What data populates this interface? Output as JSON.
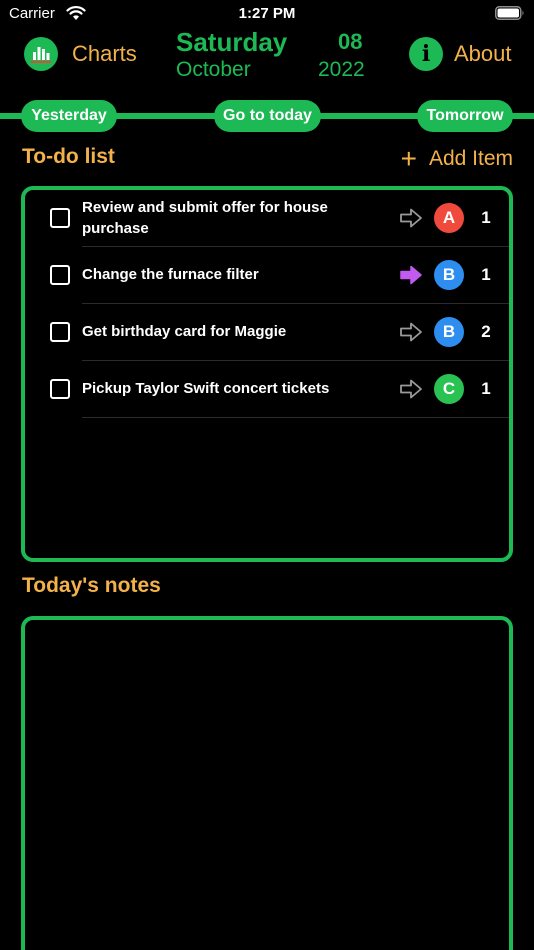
{
  "status": {
    "carrier": "Carrier",
    "time": "1:27 PM"
  },
  "header": {
    "charts_label": "Charts",
    "about_label": "About",
    "day_name": "Saturday",
    "day_number": "08",
    "month": "October",
    "year": "2022",
    "about_icon_glyph": "i"
  },
  "nav": {
    "yesterday": "Yesterday",
    "today": "Go to today",
    "tomorrow": "Tomorrow"
  },
  "todo": {
    "title": "To-do list",
    "add_label": "Add Item",
    "plus_glyph": "+",
    "items": [
      {
        "text": "Review and submit offer for house purchase",
        "priority": "A",
        "priority_color": "#ef4a3c",
        "count": "1",
        "arrow": "outline"
      },
      {
        "text": "Change the furnace filter",
        "priority": "B",
        "priority_color": "#2d8ef0",
        "count": "1",
        "arrow": "filled-purple"
      },
      {
        "text": "Get birthday card for Maggie",
        "priority": "B",
        "priority_color": "#2d8ef0",
        "count": "2",
        "arrow": "outline"
      },
      {
        "text": "Pickup Taylor Swift concert tickets",
        "priority": "C",
        "priority_color": "#29c253",
        "count": "1",
        "arrow": "outline"
      }
    ]
  },
  "notes": {
    "title": "Today's notes"
  },
  "colors": {
    "green": "#1db954",
    "orange": "#f3b14a",
    "purple": "#c25bf0"
  }
}
